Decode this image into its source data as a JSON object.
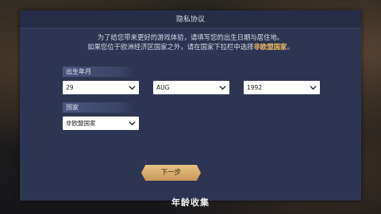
{
  "dialog": {
    "title": "隐私协议",
    "intro_line1": "为了给您带来更好的游戏体验，请填写您的出生日期与居住地。",
    "intro_line2_prefix": "如果您位于欧洲经济区国家之外，请在国家下拉栏中选择",
    "intro_line2_highlight": "非欧盟国家",
    "intro_line2_suffix": "。"
  },
  "birthdate": {
    "label": "出生年月",
    "day": "29",
    "month": "AUG",
    "year": "1992"
  },
  "country": {
    "label": "国家",
    "value": "非欧盟国家"
  },
  "next_button": "下一步",
  "footer_title": "年龄收集",
  "colors": {
    "highlight": "#f0c060",
    "dialog_bg": "#2e3552",
    "button_gold": "#d6aa6b"
  }
}
